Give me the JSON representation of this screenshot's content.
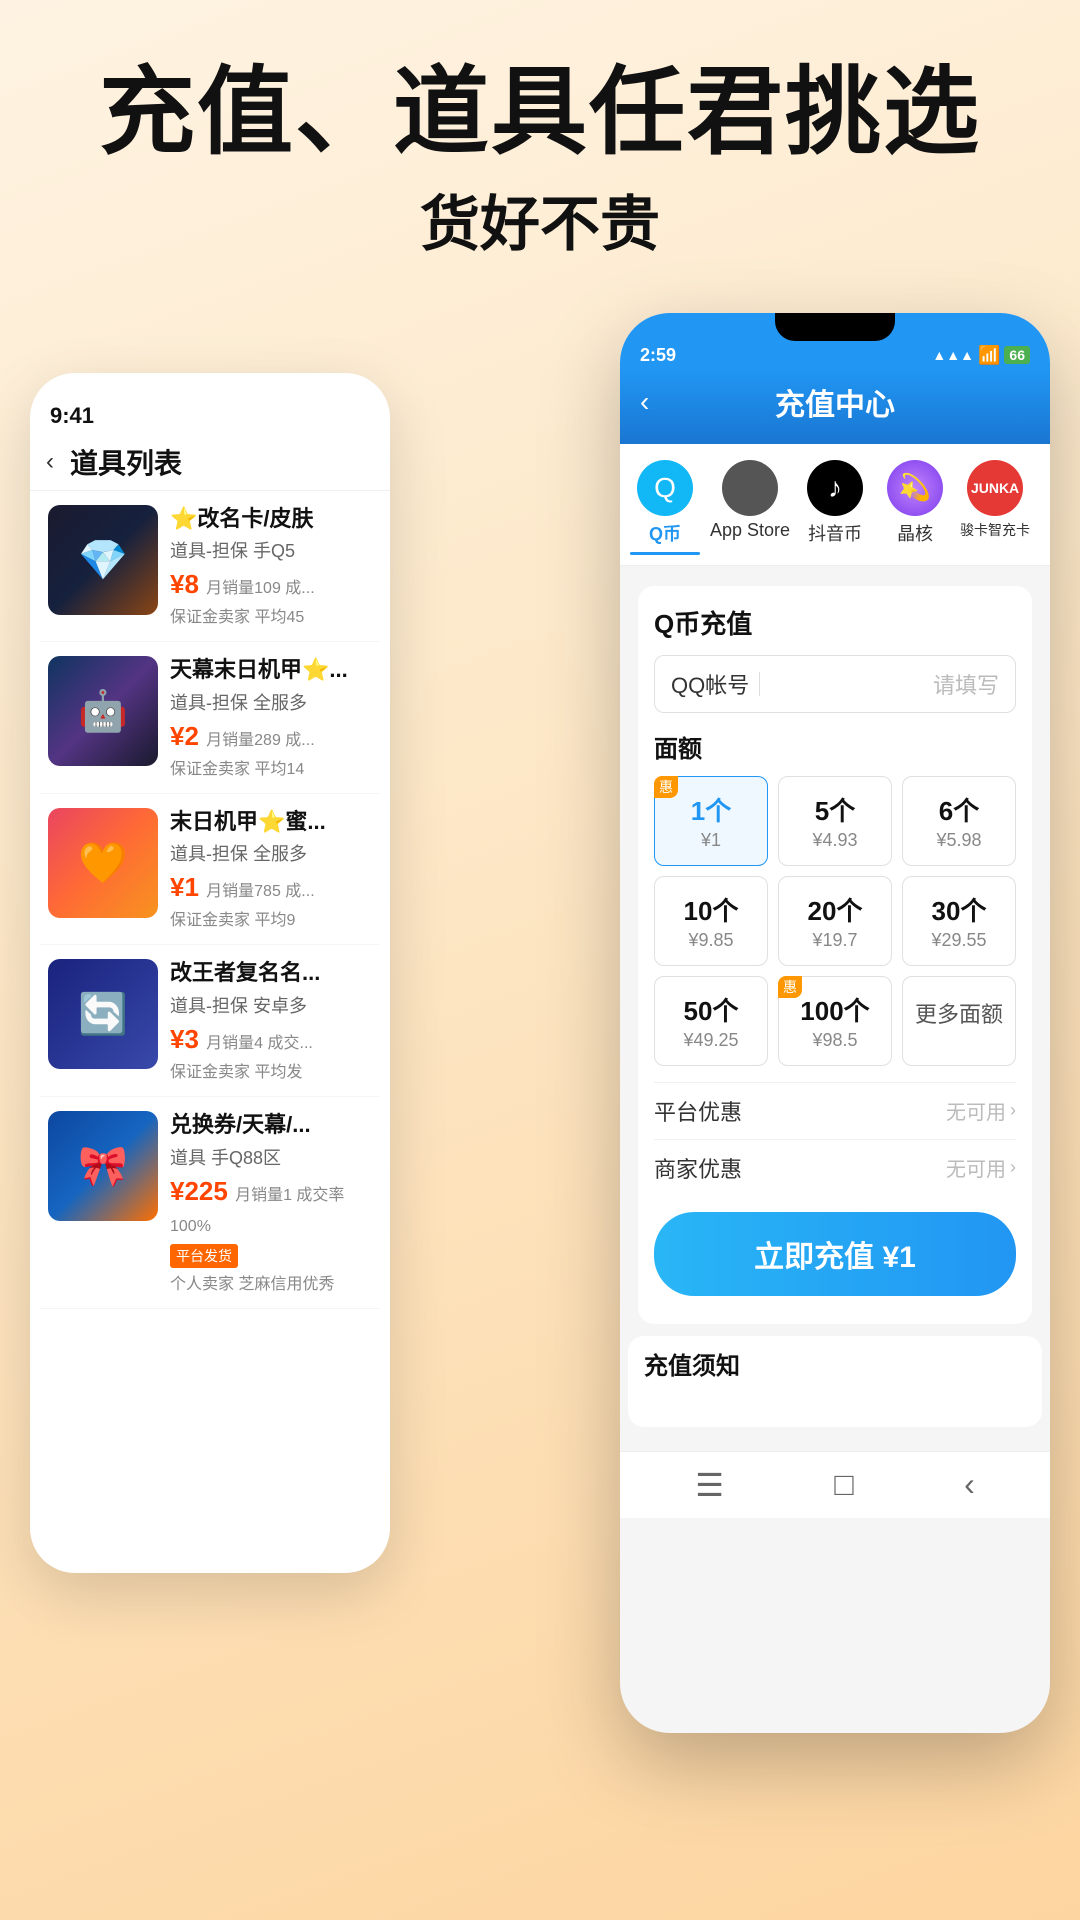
{
  "hero": {
    "title": "充值、道具任君挑选",
    "subtitle": "货好不贵"
  },
  "back_phone": {
    "status_time": "9:41",
    "header_title": "道具列表",
    "items": [
      {
        "name": "⭐改名卡/皮肤",
        "tag": "道具-担保 手Q5",
        "price": "¥8",
        "sales": "月销量109 成...",
        "guarantee": "保证金卖家 平均45",
        "emoji": "💎",
        "bg": "item-img-bg1"
      },
      {
        "name": "天幕末日机甲⭐...",
        "tag": "道具-担保 全服多",
        "price": "¥2",
        "sales": "月销量289 成...",
        "guarantee": "保证金卖家 平均14",
        "emoji": "🤖",
        "bg": "item-img-bg2"
      },
      {
        "name": "末日机甲⭐蜜...",
        "tag": "道具-担保 全服多",
        "price": "¥1",
        "sales": "月销量785 成...",
        "guarantee": "保证金卖家 平均9",
        "emoji": "🧡",
        "bg": "item-img-bg3"
      },
      {
        "name": "改王者复名名...",
        "tag": "道具-担保 安卓多",
        "price": "¥3",
        "sales": "月销量4 成交...",
        "guarantee": "保证金卖家 平均发",
        "emoji": "🔄",
        "bg": "item-img-bg4"
      },
      {
        "name": "兑换券/天幕/...",
        "tag": "道具 手Q88区",
        "price": "¥225",
        "sales": "月销量1 成交率100%",
        "guarantee": "平台发货",
        "extra": "个人卖家 芝麻信用优秀",
        "emoji": "🎀",
        "bg": "item-img-bg5",
        "platform_badge": "平台发货"
      }
    ]
  },
  "front_phone": {
    "status_time": "2:59",
    "status_icons": "▲▲▲ WiFi 66",
    "header_title": "充值中心",
    "tabs": [
      {
        "label": "Q币",
        "icon": "Q",
        "active": true
      },
      {
        "label": "App Store",
        "icon": "",
        "active": false
      },
      {
        "label": "抖音币",
        "icon": "♪",
        "active": false
      },
      {
        "label": "晶核",
        "icon": "💫",
        "active": false
      },
      {
        "label": "骏卡智充卡",
        "icon": "JUNKA",
        "active": false
      }
    ],
    "section_title": "Q币充值",
    "input_label": "QQ帐号",
    "input_placeholder": "请填写",
    "amount_label": "面额",
    "amounts": [
      {
        "main": "1个",
        "sub": "¥1",
        "active": true,
        "badge": "惠"
      },
      {
        "main": "5个",
        "sub": "¥4.93",
        "active": false,
        "badge": ""
      },
      {
        "main": "6个",
        "sub": "¥5.98",
        "active": false,
        "badge": ""
      },
      {
        "main": "10个",
        "sub": "¥9.85",
        "active": false,
        "badge": ""
      },
      {
        "main": "20个",
        "sub": "¥19.7",
        "active": false,
        "badge": ""
      },
      {
        "main": "30个",
        "sub": "¥29.55",
        "active": false,
        "badge": ""
      },
      {
        "main": "50个",
        "sub": "¥49.25",
        "active": false,
        "badge": ""
      },
      {
        "main": "100个",
        "sub": "¥98.5",
        "active": false,
        "badge": "惠"
      },
      {
        "main": "更多面额",
        "sub": "",
        "active": false,
        "badge": ""
      }
    ],
    "platform_promo": "平台优惠",
    "platform_promo_value": "无可用 >",
    "merchant_promo": "商家优惠",
    "merchant_promo_value": "无可用 >",
    "charge_button": "立即充值 ¥1",
    "notice_title": "充值须知",
    "nav_icons": [
      "≡",
      "□",
      "<"
    ]
  }
}
